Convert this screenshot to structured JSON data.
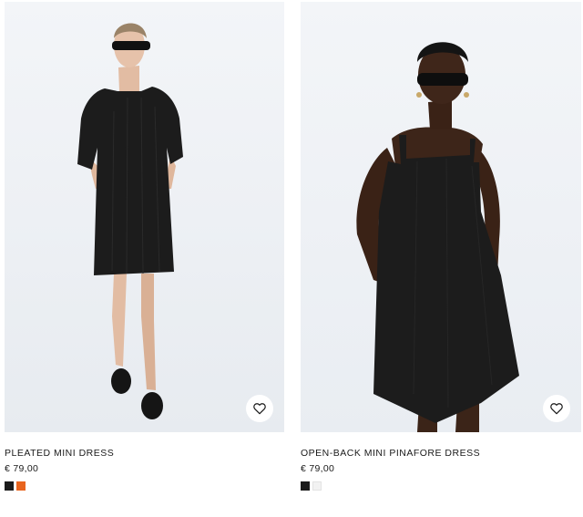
{
  "products": [
    {
      "name": "PLEATED MINI DRESS",
      "price": "€ 79,00",
      "swatches": [
        "#1b1b1b",
        "#e8641e"
      ],
      "wishlist_icon": "heart-icon"
    },
    {
      "name": "OPEN-BACK MINI PINAFORE DRESS",
      "price": "€ 79,00",
      "swatches": [
        "#1b1b1b",
        "#f2f2f2"
      ],
      "wishlist_icon": "heart-icon"
    }
  ],
  "colors": {
    "photo_bg": "#eef1f5",
    "dress": "#1c1c1c",
    "text": "#1a1a1a"
  }
}
